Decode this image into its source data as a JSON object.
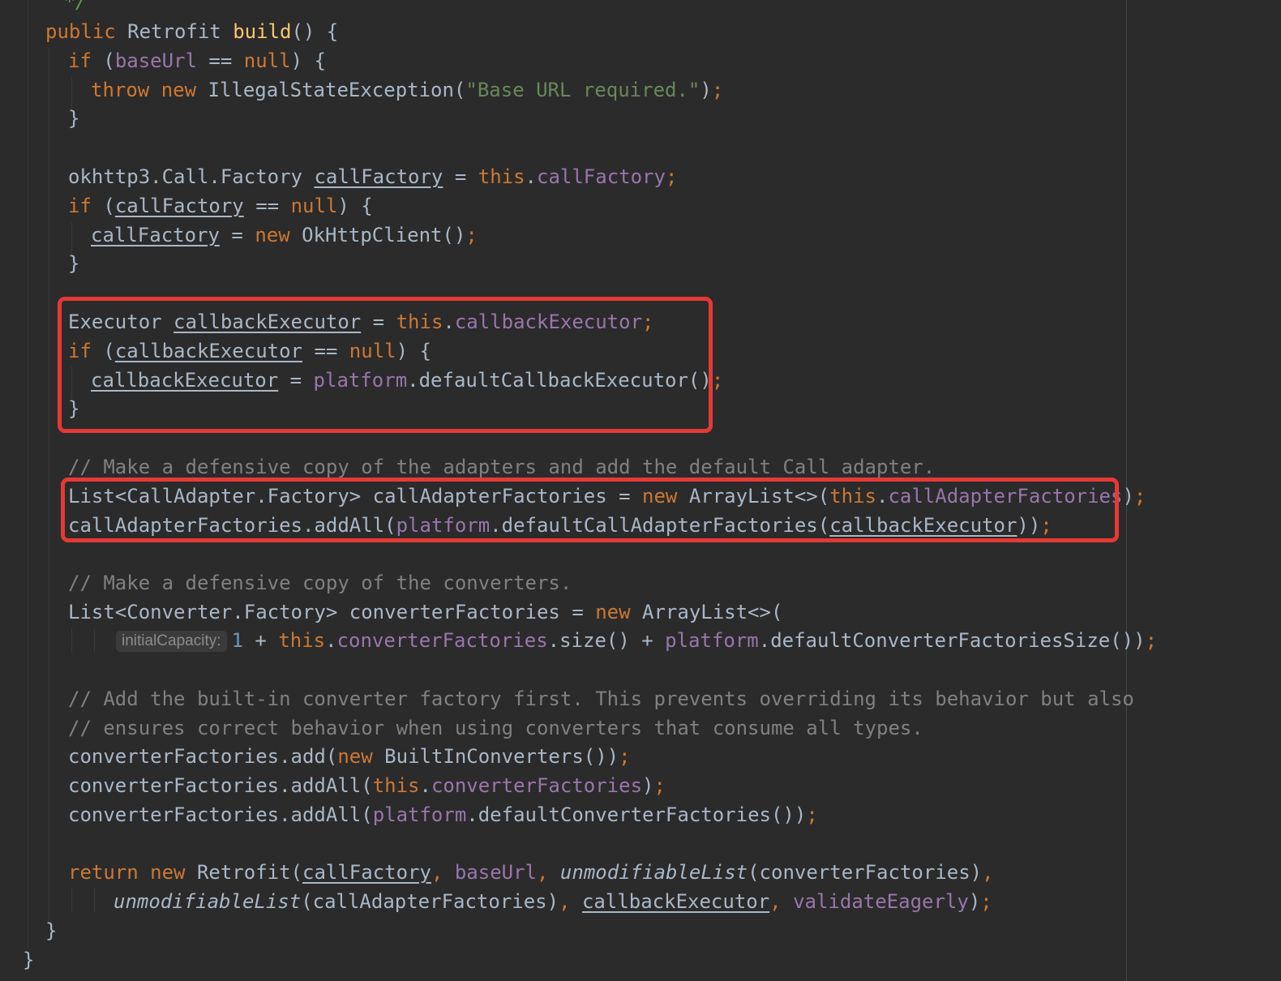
{
  "editor": {
    "lines": [
      [
        {
          "t": " */",
          "c": "doc"
        }
      ],
      [
        {
          "t": "public ",
          "c": "kw"
        },
        {
          "t": "Retrofit ",
          "c": "default"
        },
        {
          "t": "build",
          "c": "fn"
        },
        {
          "t": "() {",
          "c": "default"
        }
      ],
      [
        {
          "t": "if ",
          "c": "kw"
        },
        {
          "t": "(",
          "c": "default"
        },
        {
          "t": "baseUrl",
          "c": "field"
        },
        {
          "t": " == ",
          "c": "default"
        },
        {
          "t": "null",
          "c": "kw"
        },
        {
          "t": ") {",
          "c": "default"
        }
      ],
      [
        {
          "t": "throw new ",
          "c": "kw"
        },
        {
          "t": "IllegalStateException(",
          "c": "default"
        },
        {
          "t": "\"Base URL required.\"",
          "c": "str"
        },
        {
          "t": ")",
          "c": "default"
        },
        {
          "t": ";",
          "c": "kw"
        }
      ],
      [
        {
          "t": "}",
          "c": "default"
        }
      ],
      [],
      [
        {
          "t": "okhttp3.Call.Factory ",
          "c": "default"
        },
        {
          "t": "callFactory",
          "c": "ulvar"
        },
        {
          "t": " = ",
          "c": "default"
        },
        {
          "t": "this",
          "c": "kw"
        },
        {
          "t": ".",
          "c": "default"
        },
        {
          "t": "callFactory",
          "c": "field"
        },
        {
          "t": ";",
          "c": "kw"
        }
      ],
      [
        {
          "t": "if ",
          "c": "kw"
        },
        {
          "t": "(",
          "c": "default"
        },
        {
          "t": "callFactory",
          "c": "ulvar"
        },
        {
          "t": " == ",
          "c": "default"
        },
        {
          "t": "null",
          "c": "kw"
        },
        {
          "t": ") {",
          "c": "default"
        }
      ],
      [
        {
          "t": "callFactory",
          "c": "ulvar"
        },
        {
          "t": " = ",
          "c": "default"
        },
        {
          "t": "new ",
          "c": "kw"
        },
        {
          "t": "OkHttpClient()",
          "c": "default"
        },
        {
          "t": ";",
          "c": "kw"
        }
      ],
      [
        {
          "t": "}",
          "c": "default"
        }
      ],
      [],
      [
        {
          "t": "Executor ",
          "c": "default"
        },
        {
          "t": "callbackExecutor",
          "c": "ulvar"
        },
        {
          "t": " = ",
          "c": "default"
        },
        {
          "t": "this",
          "c": "kw"
        },
        {
          "t": ".",
          "c": "default"
        },
        {
          "t": "callbackExecutor",
          "c": "field"
        },
        {
          "t": ";",
          "c": "kw"
        }
      ],
      [
        {
          "t": "if ",
          "c": "kw"
        },
        {
          "t": "(",
          "c": "default"
        },
        {
          "t": "callbackExecutor",
          "c": "ulvar"
        },
        {
          "t": " == ",
          "c": "default"
        },
        {
          "t": "null",
          "c": "kw"
        },
        {
          "t": ") {",
          "c": "default"
        }
      ],
      [
        {
          "t": "callbackExecutor",
          "c": "ulvar"
        },
        {
          "t": " = ",
          "c": "default"
        },
        {
          "t": "platform",
          "c": "field"
        },
        {
          "t": ".defaultCallbackExecutor()",
          "c": "default"
        },
        {
          "t": ";",
          "c": "kw"
        }
      ],
      [
        {
          "t": "}",
          "c": "default"
        }
      ],
      [],
      [
        {
          "t": "// Make a defensive copy of the adapters and add the default Call adapter.",
          "c": "comment"
        }
      ],
      [
        {
          "t": "List<CallAdapter.Factory> callAdapterFactories = ",
          "c": "default"
        },
        {
          "t": "new ",
          "c": "kw"
        },
        {
          "t": "ArrayList<>(",
          "c": "default"
        },
        {
          "t": "this",
          "c": "kw"
        },
        {
          "t": ".",
          "c": "default"
        },
        {
          "t": "callAdapterFactories",
          "c": "field"
        },
        {
          "t": ")",
          "c": "default"
        },
        {
          "t": ";",
          "c": "kw"
        }
      ],
      [
        {
          "t": "callAdapterFactories.addAll(",
          "c": "default"
        },
        {
          "t": "platform",
          "c": "field"
        },
        {
          "t": ".defaultCallAdapterFactories(",
          "c": "default"
        },
        {
          "t": "callbackExecutor",
          "c": "ulvar"
        },
        {
          "t": "))",
          "c": "default"
        },
        {
          "t": ";",
          "c": "kw"
        }
      ],
      [],
      [
        {
          "t": "// Make a defensive copy of the converters.",
          "c": "comment"
        }
      ],
      [
        {
          "t": "List<Converter.Factory> converterFactories = ",
          "c": "default"
        },
        {
          "t": "new ",
          "c": "kw"
        },
        {
          "t": "ArrayList<>(",
          "c": "default"
        }
      ],
      [
        {
          "t": "initialCapacity:",
          "c": "hint"
        },
        {
          "t": "1",
          "c": "num"
        },
        {
          "t": " + ",
          "c": "default"
        },
        {
          "t": "this",
          "c": "kw"
        },
        {
          "t": ".",
          "c": "default"
        },
        {
          "t": "converterFactories",
          "c": "field"
        },
        {
          "t": ".size() + ",
          "c": "default"
        },
        {
          "t": "platform",
          "c": "field"
        },
        {
          "t": ".defaultConverterFactoriesSize())",
          "c": "default"
        },
        {
          "t": ";",
          "c": "kw"
        }
      ],
      [],
      [
        {
          "t": "// Add the built-in converter factory first. This prevents overriding its behavior but also",
          "c": "comment"
        }
      ],
      [
        {
          "t": "// ensures correct behavior when using converters that consume all types.",
          "c": "comment"
        }
      ],
      [
        {
          "t": "converterFactories.add(",
          "c": "default"
        },
        {
          "t": "new ",
          "c": "kw"
        },
        {
          "t": "BuiltInConverters())",
          "c": "default"
        },
        {
          "t": ";",
          "c": "kw"
        }
      ],
      [
        {
          "t": "converterFactories.addAll(",
          "c": "default"
        },
        {
          "t": "this",
          "c": "kw"
        },
        {
          "t": ".",
          "c": "default"
        },
        {
          "t": "converterFactories",
          "c": "field"
        },
        {
          "t": ")",
          "c": "default"
        },
        {
          "t": ";",
          "c": "kw"
        }
      ],
      [
        {
          "t": "converterFactories.addAll(",
          "c": "default"
        },
        {
          "t": "platform",
          "c": "field"
        },
        {
          "t": ".defaultConverterFactories())",
          "c": "default"
        },
        {
          "t": ";",
          "c": "kw"
        }
      ],
      [],
      [
        {
          "t": "return new ",
          "c": "kw"
        },
        {
          "t": "Retrofit(",
          "c": "default"
        },
        {
          "t": "callFactory",
          "c": "ulvar"
        },
        {
          "t": ", ",
          "c": "kw"
        },
        {
          "t": "baseUrl",
          "c": "field"
        },
        {
          "t": ", ",
          "c": "kw"
        },
        {
          "t": "unmodifiableList",
          "c": "italic"
        },
        {
          "t": "(converterFactories)",
          "c": "default"
        },
        {
          "t": ",",
          "c": "kw"
        }
      ],
      [
        {
          "t": "unmodifiableList",
          "c": "italic"
        },
        {
          "t": "(callAdapterFactories)",
          "c": "default"
        },
        {
          "t": ", ",
          "c": "kw"
        },
        {
          "t": "callbackExecutor",
          "c": "ulvar"
        },
        {
          "t": ", ",
          "c": "kw"
        },
        {
          "t": "validateEagerly",
          "c": "field"
        },
        {
          "t": ")",
          "c": "default"
        },
        {
          "t": ";",
          "c": "kw"
        }
      ],
      [
        {
          "t": "}",
          "c": "default"
        }
      ],
      [
        {
          "t": "}",
          "c": "default"
        }
      ]
    ]
  },
  "colors": {
    "background": "#2b2b2b",
    "keyword": "#cc7832",
    "method_declaration": "#ffc66d",
    "field": "#9876aa",
    "string": "#6a8759",
    "number": "#6897bb",
    "comment": "#808080",
    "highlight_box": "#e53935"
  }
}
